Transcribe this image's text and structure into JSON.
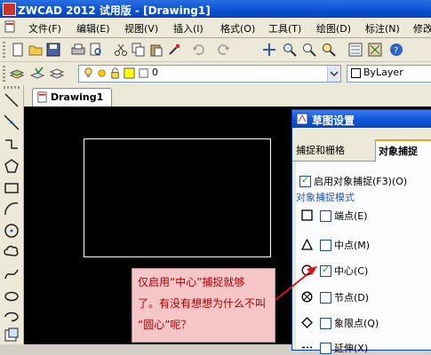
{
  "window": {
    "title": "ZWCAD 2012 试用版 - [Drawing1]"
  },
  "menu": [
    {
      "label": "文件(F)"
    },
    {
      "label": "编辑(E)"
    },
    {
      "label": "视图(V)"
    },
    {
      "label": "插入(I)"
    },
    {
      "label": "格式(O)"
    },
    {
      "label": "工具(T)"
    },
    {
      "label": "绘图(D)"
    },
    {
      "label": "标注(N)"
    },
    {
      "label": "修改"
    }
  ],
  "layers_toolbar": {
    "layer_value": "0",
    "color_value": "ByLayer"
  },
  "tabs": [
    {
      "label": "Drawing1"
    }
  ],
  "dialog": {
    "title": "草图设置",
    "tabs": [
      {
        "label": "捕捉和栅格"
      },
      {
        "label": "对象捕捉"
      }
    ],
    "enable_osnap": {
      "label": "启用对象捕捉(F3)(O)",
      "checked": true
    },
    "group_title": "对象捕捉模式",
    "snap_modes": [
      {
        "label": "端点(E)",
        "checked": false,
        "symbol": "square-icon"
      },
      {
        "label": "中点(M)",
        "checked": false,
        "symbol": "triangle-icon"
      },
      {
        "label": "中心(C)",
        "checked": true,
        "symbol": "circle-icon"
      },
      {
        "label": "节点(D)",
        "checked": false,
        "symbol": "node-icon"
      },
      {
        "label": "象限点(Q)",
        "checked": false,
        "symbol": "diamond-icon"
      },
      {
        "label": "延伸(X)",
        "checked": false,
        "symbol": "extension-icon"
      }
    ]
  },
  "callout": {
    "text": "仅启用“中心”捕捉就够\n了。有没有想想为什么不叫\n“圆心”呢？"
  },
  "colors": {
    "callout_bg": "#f5c6c8",
    "callout_text": "#b00000",
    "arrow": "#e01010"
  }
}
